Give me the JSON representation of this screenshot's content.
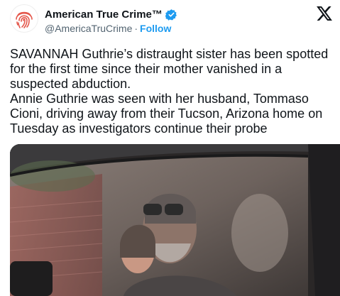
{
  "account": {
    "display_name": "American True Crime™",
    "handle": "@AmericaTruCrime",
    "separator": "·",
    "follow_label": "Follow",
    "verified": true,
    "avatar_icon": "fingerprint-icon",
    "avatar_color": "#e4574b"
  },
  "brand": {
    "logo_icon": "x-logo-icon"
  },
  "tweet": {
    "paragraph_1": "SAVANNAH Guthrie’s distraught sister has been spotted for the first time since their mother vanished in a suspected abduction.",
    "paragraph_2": "Annie Guthrie was seen with her husband, Tommaso Cioni, driving away from their Tucson, Arizona home on Tuesday as investigators continue their probe"
  },
  "media": {
    "type": "photo",
    "subject": "car-window-photo"
  },
  "colors": {
    "text": "#0f1419",
    "secondary": "#536471",
    "link": "#1d9bf0",
    "verified": "#1d9bf0"
  }
}
